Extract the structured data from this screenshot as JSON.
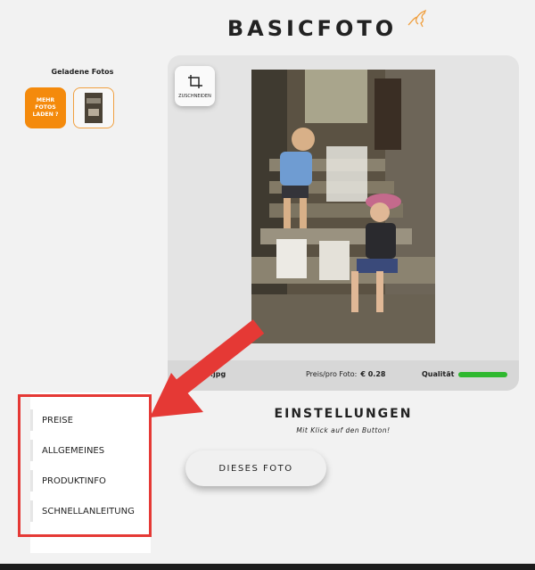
{
  "header": {
    "logo": "BASICFOTO",
    "logo_mark_icon": "kangaroo-icon"
  },
  "sidebar": {
    "title": "Geladene Fotos",
    "more_button": "MEHR\nFOTOS\nLADEN ?"
  },
  "editor": {
    "crop_label": "ZUSCHNEIDEN",
    "file_name": ".jpg",
    "price_label": "Preis/pro Foto:",
    "price_value": "€ 0.28",
    "quality_label": "Qualität",
    "quality_level": 1.0
  },
  "settings": {
    "title": "EINSTELLUNGEN",
    "subtitle": "Mit Klick auf den Button!",
    "photo_button": "DIESES FOTO"
  },
  "menu": {
    "items": [
      {
        "label": "PREISE"
      },
      {
        "label": "ALLGEMEINES"
      },
      {
        "label": "PRODUKTINFO"
      },
      {
        "label": "SCHNELLANLEITUNG"
      }
    ]
  },
  "colors": {
    "accent": "#f48a0c",
    "quality": "#2fb82f",
    "highlight": "#e53935"
  }
}
